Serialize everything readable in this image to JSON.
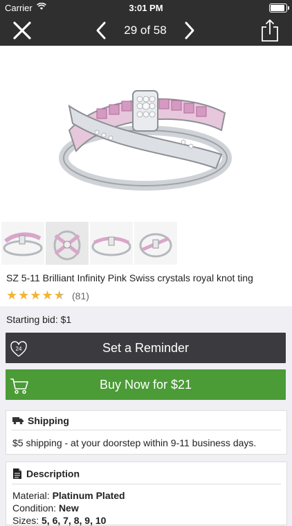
{
  "status": {
    "carrier": "Carrier",
    "time": "3:01 PM"
  },
  "nav": {
    "counter": "29 of 58"
  },
  "product": {
    "title": "SZ 5-11  Brilliant Infinity Pink Swiss crystals royal knot ting",
    "rating": 4.5,
    "review_count": "(81)",
    "starting_bid": "Starting bid: $1"
  },
  "actions": {
    "reminder_label": "Set a Reminder",
    "reminder_badge": "24",
    "buy_label": "Buy Now for $21"
  },
  "shipping": {
    "heading": "Shipping",
    "text": "$5 shipping - at your doorstep within 9-11 business days."
  },
  "description": {
    "heading": "Description",
    "material_label": "Material:",
    "material_value": "Platinum Plated",
    "condition_label": "Condition:",
    "condition_value": "New",
    "sizes_label": "Sizes:",
    "sizes_value": "5, 6, 7, 8, 9, 10"
  },
  "colors": {
    "header": "#2f2f2f",
    "reminder": "#3b3b3f",
    "buy": "#4b9b37",
    "star": "#f3b431"
  }
}
